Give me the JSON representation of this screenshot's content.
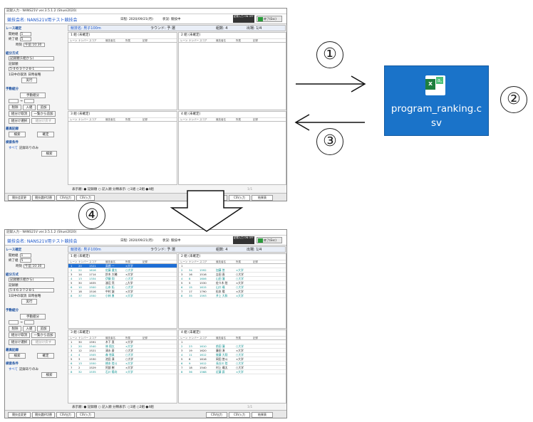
{
  "steps": {
    "one": "①",
    "two": "②",
    "three": "③",
    "four": "④"
  },
  "file": {
    "name": "program_ranking.csv",
    "icon": "excel-csv-file-icon",
    "icon_letter": "x",
    "icon_sub": "a,",
    "bg": "#1a73c9"
  },
  "top_window": {
    "title": "記録入力 - NANS21V ver.3.5.1.2 (Shuei2020)",
    "competition": "競技会名: NANS21V用テスト競技会",
    "date": "日程: 2020/09/21(月)",
    "status": "状況: 競技中",
    "onoff": "記録入力 ON OFF",
    "exit": "終了(Esc)"
  },
  "bottom_window": {
    "title": "記録入力 - NANS21V ver.3.5.1.2 (Shuei2020)",
    "competition": "競技会名: NANS21V用テスト競技会",
    "date": "日程: 2020/09/21(月)",
    "status": "状況: 競技中",
    "onoff": "記録入力 ON OFF",
    "exit": "終了(Esc)"
  },
  "side": {
    "race": "レース確定",
    "start_group": "開始組",
    "end_group": "終了組",
    "time_label": "時刻",
    "time_value": "午前 10:30",
    "start_group_value": "1",
    "end_group_value": "5",
    "method": "組分方式",
    "method_value": "記録順(1組から)",
    "order": "記録順",
    "lane": "レーン順",
    "lane_value": "5-4-6-3-7-2-8-1",
    "check1": "1日中の取消",
    "check2": "日時省略",
    "exec": "実行",
    "manual": "手動組分",
    "manual_btn": "手動組分",
    "group": "組",
    "arrow": "→",
    "group2": "組",
    "delete": "削除",
    "insert": "入組",
    "add": "追加",
    "b1": "組分け取消",
    "b2": "一覧から追加",
    "b3": "組分け選択",
    "b4": "組分け戻す",
    "record": "最高記録",
    "r1": "検索",
    "r2": "確定",
    "filter": "検索条件",
    "f1": "すべて",
    "f2": "記録ありのみ",
    "f3": "検索"
  },
  "event_header": {
    "event": "競技名: 男子100m",
    "round": "ラウンド: 予 選",
    "heats": "組数: 4",
    "entries": "出場: 1/4"
  },
  "columns": [
    "レーン",
    "ナンバー",
    "スコア",
    "競技者名",
    "所属",
    "記録"
  ],
  "block_titles": [
    "1 組 (未確定)",
    "2 組 (未確定)",
    "3 組 (未確定)",
    "4 組 (未確定)"
  ],
  "bottom_rows": {
    "b1": [
      [
        "1",
        "20",
        "1521",
        "高橋 一",
        "×大学"
      ],
      [
        "2",
        "22",
        "1616",
        "佐藤 健太",
        "○大学"
      ],
      [
        "3",
        "14",
        "1714",
        "鈴木 大輔",
        "×大学"
      ],
      [
        "4",
        "13",
        "1334",
        "伊藤 翔",
        "○大学"
      ],
      [
        "5",
        "30",
        "1635",
        "渡辺 亮",
        "△大学"
      ],
      [
        "6",
        "10",
        "1500",
        "山本 拓",
        "○大学"
      ],
      [
        "7",
        "18",
        "1516",
        "中村 誠",
        "×大学"
      ],
      [
        "8",
        "37",
        "1550",
        "小林 勇",
        "×大学"
      ]
    ],
    "b2": [
      [
        "1",
        "",
        "",
        "",
        ""
      ],
      [
        "2",
        "34",
        "1592",
        "加藤 悠",
        "×大学"
      ],
      [
        "3",
        "16",
        "1516",
        "吉田 直",
        "○大学"
      ],
      [
        "4",
        "8",
        "1606",
        "山田 蓮",
        "○大学"
      ],
      [
        "5",
        "5",
        "1530",
        "佐々木 陸",
        "×大学"
      ],
      [
        "6",
        "15",
        "1615",
        "山口 颯",
        "○大学"
      ],
      [
        "7",
        "17",
        "1790",
        "松本 陽",
        "×大学"
      ],
      [
        "8",
        "35",
        "1593",
        "井上 大和",
        "×大学"
      ]
    ],
    "b3": [
      [
        "1",
        "30",
        "1591",
        "木下 直",
        "×大学"
      ],
      [
        "2",
        "20",
        "1540",
        "林 翔太",
        "×大学"
      ],
      [
        "3",
        "12",
        "1521",
        "清水 蒼",
        "○大学"
      ],
      [
        "4",
        "4",
        "1505",
        "森 悠真",
        "○大学"
      ],
      [
        "5",
        "3",
        "1530",
        "池田 湊",
        "○大学"
      ],
      [
        "6",
        "13",
        "1550",
        "橋本 陸斗",
        "×大学"
      ],
      [
        "7",
        "2",
        "1529",
        "阿部 樹",
        "×大学"
      ],
      [
        "8",
        "32",
        "1535",
        "石川 陽向",
        "×大学"
      ]
    ],
    "b4": [
      [
        "1",
        "",
        "",
        "",
        ""
      ],
      [
        "2",
        "23",
        "1610",
        "前田 蓮",
        "○大学"
      ],
      [
        "3",
        "19",
        "1620",
        "藤田 湊",
        "×大学"
      ],
      [
        "4",
        "11",
        "1612",
        "後藤 大翔",
        "○大学"
      ],
      [
        "5",
        "6",
        "1616",
        "岡田 悠斗",
        "×大学"
      ],
      [
        "6",
        "9",
        "1612",
        "長谷川 陸",
        "○大学"
      ],
      [
        "7",
        "18",
        "1540",
        "村上 颯太",
        "○大学"
      ],
      [
        "8",
        "36",
        "1568",
        "近藤 蒼",
        "×大学"
      ]
    ]
  },
  "display": "表示順: ● 記録順 ○ 記入順   分類表示: ○1組 ○2組 ●4組",
  "paging": "1/1",
  "footer": [
    "競技会変更",
    "競技選択切替",
    "CSV出力",
    "CSV入力"
  ],
  "footer_right": [
    "CSV出力",
    "CSV入力",
    "結果表"
  ]
}
